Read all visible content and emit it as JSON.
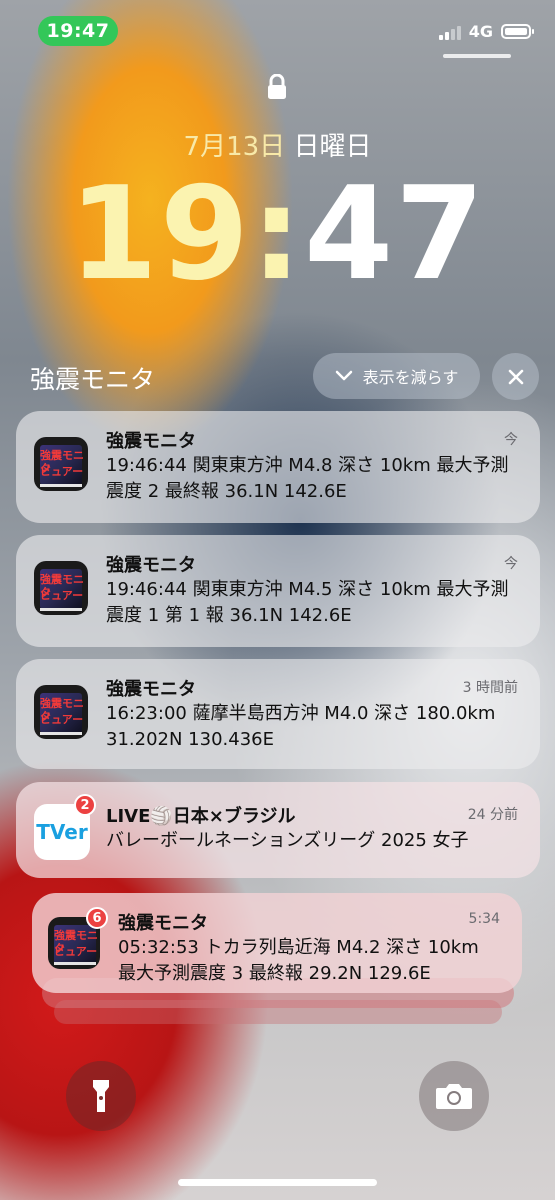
{
  "status_bar": {
    "time": "19:47",
    "network": "4G",
    "signal_bars": 2,
    "battery_level": 0.95
  },
  "lock_screen": {
    "date_main": "7月13日",
    "date_weekday": "日曜日",
    "time_hours": "19:",
    "time_minutes": "47"
  },
  "group": {
    "title": "強震モニタ",
    "show_less_label": "表示を減らす",
    "close_icon": "close-icon"
  },
  "notifications": [
    {
      "app": "強震モニタ",
      "time": "今",
      "body": "19:46:44 関東東方沖 M4.8 深さ 10km 最大予測震度 2 最終報 36.1N 142.6E"
    },
    {
      "app": "強震モニタ",
      "time": "今",
      "body": "19:46:44 関東東方沖 M4.5 深さ 10km 最大予測震度 1 第 1 報 36.1N 142.6E"
    },
    {
      "app": "強震モニタ",
      "time": "3 時間前",
      "body": "16:23:00 薩摩半島西方沖 M4.0 深さ 180.0km 31.202N 130.436E"
    },
    {
      "app": "LIVE🏐日本×ブラジル",
      "time": "24 分前",
      "body": "バレーボールネーションズリーグ 2025 女子",
      "badge": "2",
      "icon_text": "TVer"
    },
    {
      "app": "強震モニタ",
      "time": "5:34",
      "body": "05:32:53 トカラ列島近海 M4.2 深さ 10km 最大予測震度 3 最終報 29.2N 129.6E",
      "badge": "6"
    }
  ],
  "app_icon_text": {
    "line1": "強震モニタ",
    "line2": "ビュアー"
  },
  "bottom": {
    "left_icon": "flashlight-icon",
    "right_icon": "camera-icon"
  },
  "colors": {
    "time_pill": "#33c759",
    "badge": "#ec4141"
  }
}
